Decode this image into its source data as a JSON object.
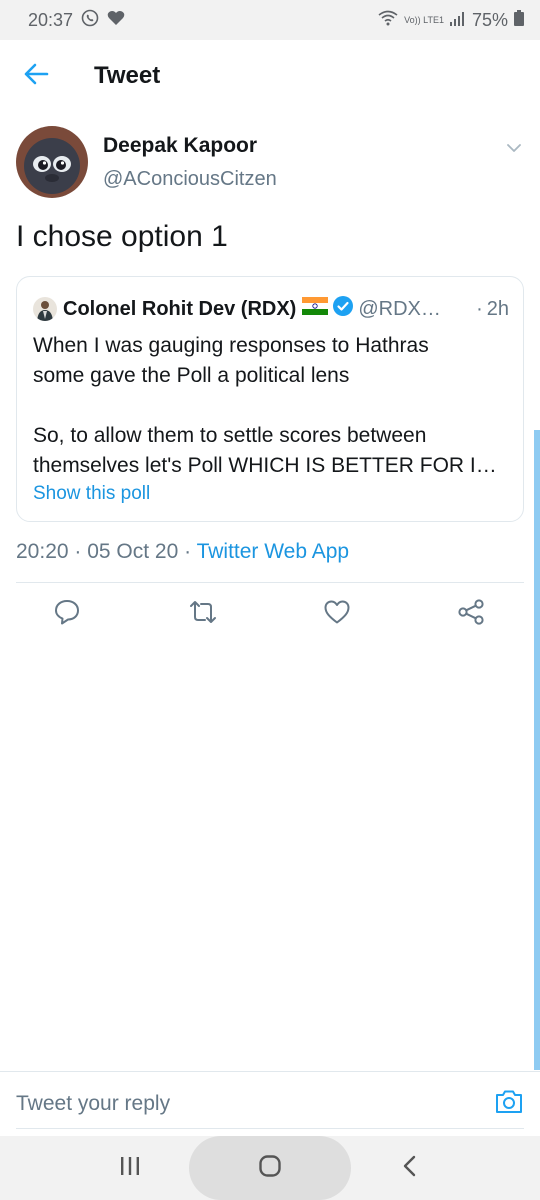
{
  "status_bar": {
    "time": "20:37",
    "network_label": "Vo)) LTE1",
    "battery": "75%"
  },
  "header": {
    "title": "Tweet",
    "back_icon": "arrow-left-icon"
  },
  "tweet": {
    "author_name": "Deepak Kapoor",
    "author_handle": "@AConciousCitzen",
    "text": "I chose option 1",
    "timestamp": "20:20 · 05 Oct 20 · ",
    "source": "Twitter Web App"
  },
  "quoted_tweet": {
    "author_name": "Colonel Rohit Dev (RDX)",
    "author_handle": "@RDX…",
    "separator": "·",
    "time": "2h",
    "lines": [
      "When I was gauging responses to Hathras",
      "some gave the Poll a political lens",
      "",
      "So, to allow them to settle scores between",
      "themselves let's Poll WHICH IS BETTER FOR I…"
    ],
    "poll_link": "Show this poll"
  },
  "actions": [
    {
      "name": "reply-icon"
    },
    {
      "name": "retweet-icon"
    },
    {
      "name": "like-icon"
    },
    {
      "name": "share-icon"
    }
  ],
  "reply_box": {
    "placeholder": "Tweet your reply"
  },
  "colors": {
    "accent": "#1da1f2",
    "link": "#1b95e0",
    "secondary_text": "#657786",
    "primary_text": "#14171a",
    "divider": "#e1e8ed"
  }
}
